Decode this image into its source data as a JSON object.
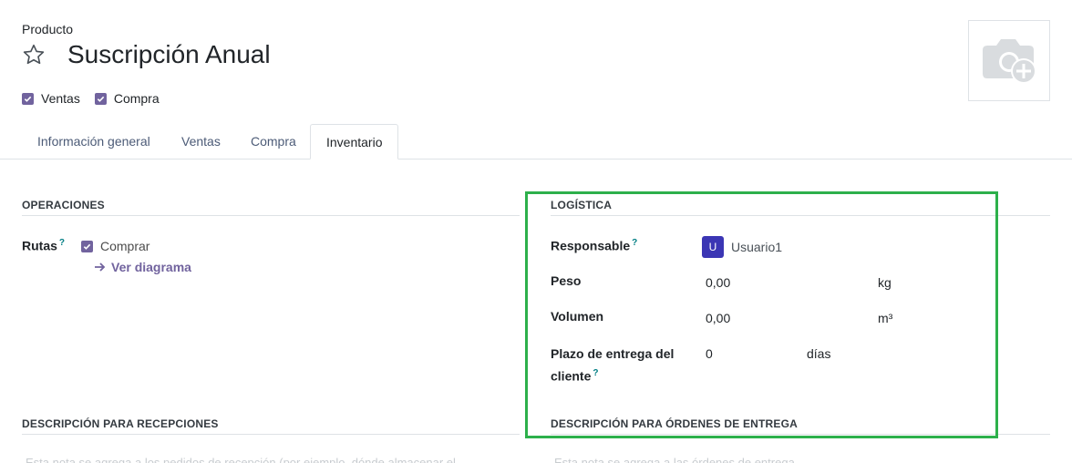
{
  "header": {
    "label": "Producto",
    "title": "Suscripción Anual",
    "checkboxes": [
      {
        "label": "Ventas",
        "checked": true
      },
      {
        "label": "Compra",
        "checked": true
      }
    ]
  },
  "tabs": [
    {
      "label": "Información general",
      "active": false
    },
    {
      "label": "Ventas",
      "active": false
    },
    {
      "label": "Compra",
      "active": false
    },
    {
      "label": "Inventario",
      "active": true
    }
  ],
  "operaciones": {
    "heading": "OPERACIONES",
    "rutas_label": "Rutas",
    "help": "?",
    "route": {
      "label": "Comprar",
      "checked": true
    },
    "link": "Ver diagrama"
  },
  "logistica": {
    "heading": "LOGÍSTICA",
    "responsable_label": "Responsable",
    "responsable_help": "?",
    "responsable_initial": "U",
    "responsable_value": "Usuario1",
    "peso_label": "Peso",
    "peso_value": "0,00",
    "peso_unit": "kg",
    "volumen_label": "Volumen",
    "volumen_value": "0,00",
    "volumen_unit": "m³",
    "plazo_label_1": "Plazo de entrega del",
    "plazo_label_2": "cliente",
    "plazo_help": "?",
    "plazo_value": "0",
    "plazo_unit": "días"
  },
  "descripciones": {
    "recepciones_heading": "DESCRIPCIÓN PARA RECEPCIONES",
    "recepciones_placeholder": "Esta nota se agrega a los pedidos de recepción (por ejemplo, dónde almacenar el",
    "entrega_heading": "DESCRIPCIÓN PARA ÓRDENES DE ENTREGA",
    "entrega_placeholder": "Esta nota se agrega a las órdenes de entrega."
  },
  "colors": {
    "accent": "#71639e",
    "avatar": "#3b36b4",
    "highlight": "#2db04b",
    "help": "#017e84"
  }
}
